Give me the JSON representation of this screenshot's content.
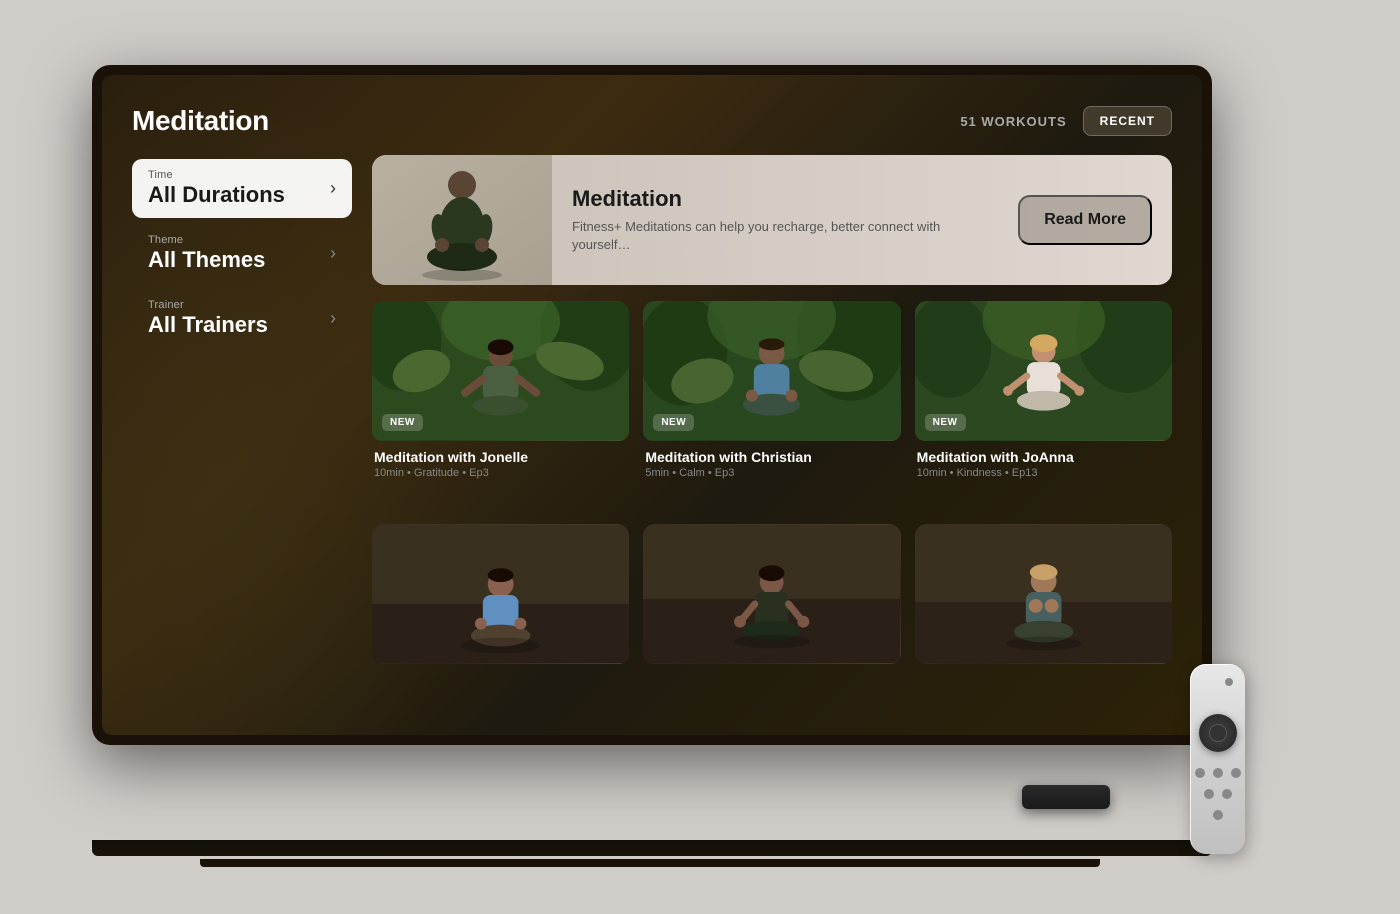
{
  "page": {
    "title": "Meditation",
    "workouts_count": "51 WORKOUTS",
    "recent_btn": "RECENT"
  },
  "filters": [
    {
      "id": "time",
      "label": "Time",
      "value": "All Durations",
      "active": true
    },
    {
      "id": "theme",
      "label": "Theme",
      "value": "All Themes",
      "active": false
    },
    {
      "id": "trainer",
      "label": "Trainer",
      "value": "All Trainers",
      "active": false
    }
  ],
  "banner": {
    "title": "Meditation",
    "description": "Fitness+ Meditations can help you recharge, better connect with yourself…",
    "read_more": "Read More"
  },
  "workouts": [
    {
      "id": 1,
      "name": "Meditation with Jonelle",
      "meta": "10min • Gratitude • Ep3",
      "is_new": true,
      "bg_class": "thumb-bg-1"
    },
    {
      "id": 2,
      "name": "Meditation with Christian",
      "meta": "5min • Calm • Ep3",
      "is_new": true,
      "bg_class": "thumb-bg-2"
    },
    {
      "id": 3,
      "name": "Meditation with JoAnna",
      "meta": "10min • Kindness • Ep13",
      "is_new": true,
      "bg_class": "thumb-bg-3"
    },
    {
      "id": 4,
      "name": "",
      "meta": "",
      "is_new": false,
      "bg_class": "thumb-bg-4"
    },
    {
      "id": 5,
      "name": "",
      "meta": "",
      "is_new": false,
      "bg_class": "thumb-bg-5"
    },
    {
      "id": 6,
      "name": "",
      "meta": "",
      "is_new": false,
      "bg_class": "thumb-bg-6"
    }
  ],
  "new_badge_label": "NEW",
  "chevron": "›"
}
